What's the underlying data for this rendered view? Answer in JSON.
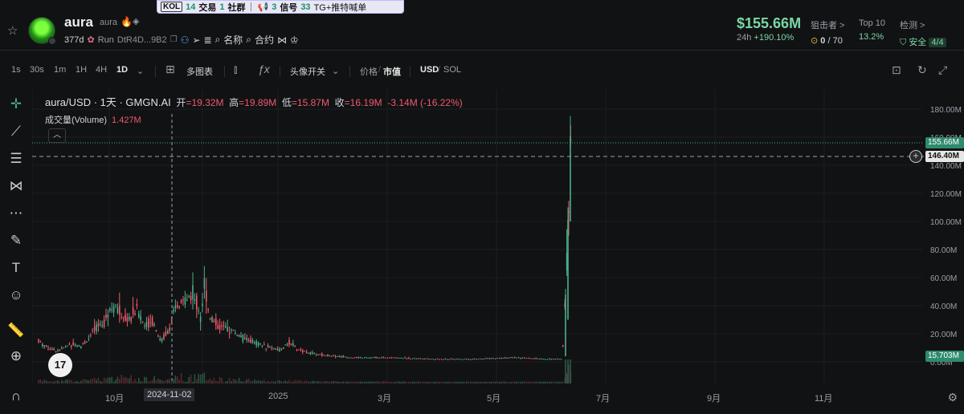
{
  "banner": {
    "kol_label": "KOL",
    "trade_count": "14",
    "trade_label": "交易",
    "social_count": "1",
    "social_label": "社群",
    "signal_count": "3",
    "signal_label": "信号",
    "tg_count": "33",
    "tg_label": "TG+推特喊单"
  },
  "token": {
    "name": "aura",
    "symbol": "aura",
    "age": "377d",
    "platform": "Run",
    "address": "DtR4D...9B2",
    "name_search": "名称",
    "contract_search": "合约"
  },
  "price": {
    "market_cap": "$155.66M",
    "period": "24h",
    "change": "+190.10%"
  },
  "stats": {
    "sniper_label": "狙击者 >",
    "sniper_count": "0",
    "sniper_total": "/ 70",
    "top10_label": "Top 10",
    "top10_value": "13.2%",
    "check_label": "检测 >",
    "check_safe": "安全",
    "check_score": "4/4"
  },
  "toolbar": {
    "intervals": [
      "1s",
      "30s",
      "1m",
      "1H",
      "4H",
      "1D"
    ],
    "active_interval": "1D",
    "multi_chart": "多图表",
    "avatar_toggle": "头像开关",
    "price_label": "价格",
    "mcap_label": "市值",
    "currency_usd": "USD",
    "currency_sol": "SOL"
  },
  "chart_header": {
    "symbol": "aura/USD · 1天 · GMGN.AI",
    "open_label": "开",
    "open": "=19.32M",
    "high_label": "高",
    "high": "=19.89M",
    "low_label": "低",
    "low": "=15.87M",
    "close_label": "收",
    "close": "=16.19M",
    "change": "-3.14M (-16.22%)",
    "volume_label": "成交量(Volume)",
    "volume_value": "1.427M"
  },
  "axis_tags": {
    "last": "155.66M",
    "cross": "146.40M",
    "low": "15.703M",
    "cross_date": "2024-11-02"
  },
  "chart_data": {
    "type": "candlestick",
    "title": "aura/USD · 1天 · GMGN.AI",
    "y_ticks": [
      "180.00M",
      "160.00M",
      "140.00M",
      "120.00M",
      "100.00M",
      "80.00M",
      "60.00M",
      "40.00M",
      "20.00M",
      "0.00M"
    ],
    "x_ticks": [
      "10月",
      "2025",
      "3月",
      "5月",
      "7月",
      "9月",
      "11月"
    ],
    "ylim": [
      0,
      190
    ],
    "unit": "M",
    "colors": {
      "up": "#4caf8a",
      "down": "#ef5a6f",
      "grid": "#1c1e22"
    },
    "series_profile": [
      [
        0,
        22
      ],
      [
        10,
        14
      ],
      [
        20,
        10
      ],
      [
        30,
        8
      ],
      [
        40,
        10
      ],
      [
        50,
        13
      ],
      [
        60,
        11
      ],
      [
        70,
        16
      ],
      [
        80,
        24
      ],
      [
        90,
        30
      ],
      [
        100,
        42
      ],
      [
        110,
        34
      ],
      [
        120,
        30
      ],
      [
        130,
        38
      ],
      [
        140,
        26
      ],
      [
        150,
        30
      ],
      [
        160,
        14
      ],
      [
        170,
        24
      ],
      [
        180,
        38
      ],
      [
        190,
        44
      ],
      [
        200,
        48
      ],
      [
        210,
        34
      ],
      [
        215,
        58
      ],
      [
        220,
        34
      ],
      [
        230,
        26
      ],
      [
        240,
        24
      ],
      [
        250,
        22
      ],
      [
        260,
        18
      ],
      [
        270,
        15
      ],
      [
        280,
        13
      ],
      [
        290,
        11
      ],
      [
        300,
        10
      ],
      [
        310,
        8
      ],
      [
        320,
        14
      ],
      [
        330,
        9
      ],
      [
        340,
        7
      ],
      [
        350,
        6
      ],
      [
        360,
        5
      ],
      [
        380,
        4
      ],
      [
        400,
        3
      ],
      [
        450,
        3
      ],
      [
        500,
        2
      ],
      [
        550,
        2
      ],
      [
        600,
        3
      ],
      [
        640,
        2
      ],
      [
        660,
        2
      ],
      [
        664,
        50
      ],
      [
        668,
        110
      ],
      [
        672,
        175
      ]
    ]
  }
}
